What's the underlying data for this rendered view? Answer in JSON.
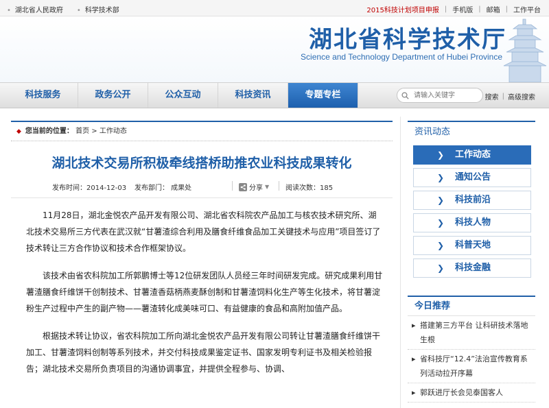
{
  "topbar": {
    "left": [
      "湖北省人民政府",
      "科学技术部"
    ],
    "right": [
      "2015科技计划项目申报",
      "手机版",
      "邮箱",
      "工作平台"
    ]
  },
  "header": {
    "title": "湖北省科学技术厅",
    "subtitle": "Science and Technology Department of Hubei Province"
  },
  "nav": {
    "items": [
      "科技服务",
      "政务公开",
      "公众互动",
      "科技资讯",
      "专题专栏"
    ],
    "search_placeholder": "请输入关键字",
    "search_label": "搜索",
    "advanced_label": "高级搜索"
  },
  "breadcrumb": {
    "prefix": "您当前的位置：",
    "home": "首页",
    "arrow": ">",
    "current": "工作动态"
  },
  "article": {
    "title": "湖北技术交易所积极牵线搭桥助推农业科技成果转化",
    "publish": "发布时间：2014-12-03",
    "dept": "发布部门： 成果处",
    "share": "分享",
    "views": "阅读次数：185",
    "paragraphs": [
      "11月28日，湖北金悦农产品开发有限公司、湖北省农科院农产品加工与核农技术研究所、湖北技术交易所三方代表在武汉就“甘薯渣综合利用及膳食纤维食品加工关键技术与应用”项目签订了技术转让三方合作协议和技术合作框架协议。",
      "该技术由省农科院加工所郭鹏博士等12位研发团队人员经三年时间研发完成。研究成果利用甘薯渣膳食纤维饼干创制技术、甘薯渣香菇柄燕麦酥创制和甘薯渣饲料化生产等生化技术，将甘薯淀粉生产过程中产生的副产物——薯渣转化成美味可口、有益健康的食品和高附加值产品。",
      "根据技术转让协议，省农科院加工所向湖北金悦农产品开发有限公司转让甘薯渣膳食纤维饼干加工、甘薯渣饲料创制等系列技术，并交付科技成果鉴定证书、国家发明专利证书及相关检验报告；湖北技术交易所负责项目的沟通协调事宜，并提供全程参与、协调、"
    ]
  },
  "sidebar": {
    "heading": "资讯动态",
    "menu": [
      "工作动态",
      "通知公告",
      "科技前沿",
      "科技人物",
      "科普天地",
      "科技金融"
    ],
    "active_index": 0,
    "recommend_heading": "今日推荐",
    "recommend": [
      "搭建第三方平台 让科研技术落地生根",
      "省科技厅“12.4”法治宣传教育系列活动拉开序幕",
      "郭跃进厅长会见泰国客人"
    ]
  },
  "colors": {
    "brand_blue": "#1f5fa8",
    "active_nav": "#2a6cb8",
    "accent_red": "#c00000"
  }
}
